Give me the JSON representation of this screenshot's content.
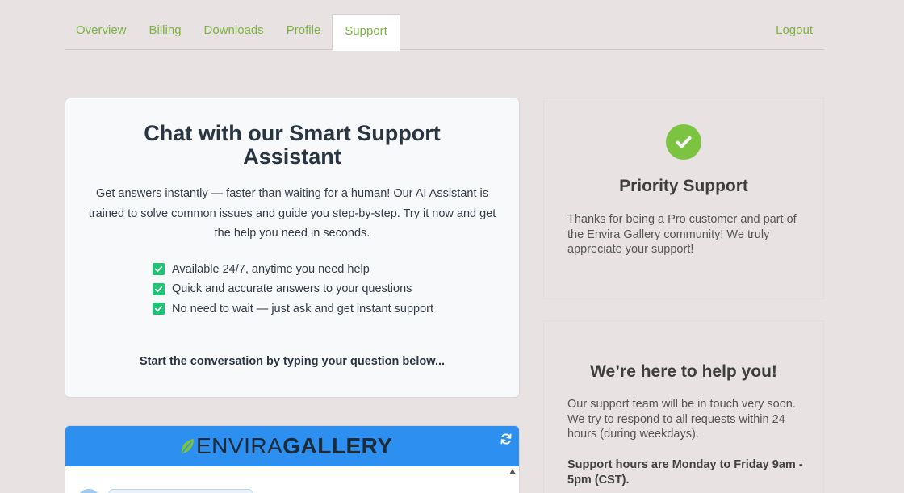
{
  "nav": {
    "tabs": [
      {
        "label": "Overview"
      },
      {
        "label": "Billing"
      },
      {
        "label": "Downloads"
      },
      {
        "label": "Profile"
      },
      {
        "label": "Support"
      }
    ],
    "active_tab": "Support",
    "logout_label": "Logout"
  },
  "chat_card": {
    "title": "Chat with our Smart Support Assistant",
    "description": "Get answers instantly — faster than waiting for a human! Our AI Assistant is trained to solve common issues and guide you step-by-step. Try it now and get the help you need in seconds.",
    "features": [
      "Available 24/7, anytime you need help",
      "Quick and accurate answers to your questions",
      "No need to wait — just ask and get instant support"
    ],
    "prompt": "Start the conversation by typing your question below..."
  },
  "widget": {
    "logo_light": "ENVIRA",
    "logo_bold": "GALLERY",
    "header_color": "#2d8ff0",
    "refresh_icon": "refresh-icon"
  },
  "priority_card": {
    "icon": "check-circle-icon",
    "title": "Priority Support",
    "text": "Thanks for being a Pro customer and part of the Envira Gallery community! We truly appreciate your support!"
  },
  "help_card": {
    "title": "We’re here to help you!",
    "text": "Our support team will be in touch very soon. We try to respond to all requests within 24 hours (during weekdays).",
    "hours": "Support hours are Monday to Friday 9am - 5pm (CST)."
  },
  "colors": {
    "accent_green": "#7cb342",
    "check_green": "#1fc374",
    "page_background": "#e8e3e2"
  }
}
